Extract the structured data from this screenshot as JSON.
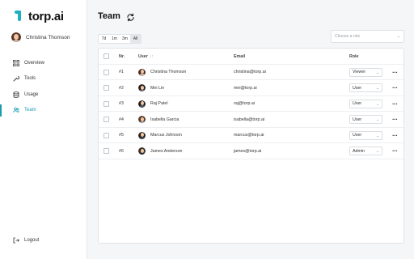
{
  "app": {
    "logo_text": "torp.ai",
    "brand_color": "#1bb1c1"
  },
  "profile": {
    "name": "Christina Thomson"
  },
  "nav": [
    {
      "label": "Overview",
      "icon": "grid-icon",
      "active": false
    },
    {
      "label": "Tools",
      "icon": "wrench-icon",
      "active": false
    },
    {
      "label": "Usage",
      "icon": "database-icon",
      "active": false
    },
    {
      "label": "Team",
      "icon": "users-icon",
      "active": true
    }
  ],
  "logout_label": "Logout",
  "page": {
    "title": "Team"
  },
  "range": {
    "options": [
      "7d",
      "1m",
      "3m",
      "All"
    ],
    "selected": "All"
  },
  "role_filter": {
    "placeholder": "Choose a role"
  },
  "table": {
    "headers": {
      "nr": "Nr.",
      "user": "User",
      "sort_glyph": "↓↑",
      "email": "Email",
      "role": "Role"
    },
    "rows": [
      {
        "nr": "#1",
        "name": "Christina Thomson",
        "email": "christina@torp.ai",
        "role": "Viewer"
      },
      {
        "nr": "#2",
        "name": "Mei Lin",
        "email": "mei@torp.ai",
        "role": "User"
      },
      {
        "nr": "#3",
        "name": "Raj Patel",
        "email": "raj@torp.ai",
        "role": "User"
      },
      {
        "nr": "#4",
        "name": "Isabella Garcia",
        "email": "isabella@torp.ai",
        "role": "User"
      },
      {
        "nr": "#5",
        "name": "Marcus Johnson",
        "email": "marcus@torp.ai",
        "role": "User"
      },
      {
        "nr": "#6",
        "name": "James Anderson",
        "email": "james@torp.ai",
        "role": "Admin"
      }
    ]
  }
}
